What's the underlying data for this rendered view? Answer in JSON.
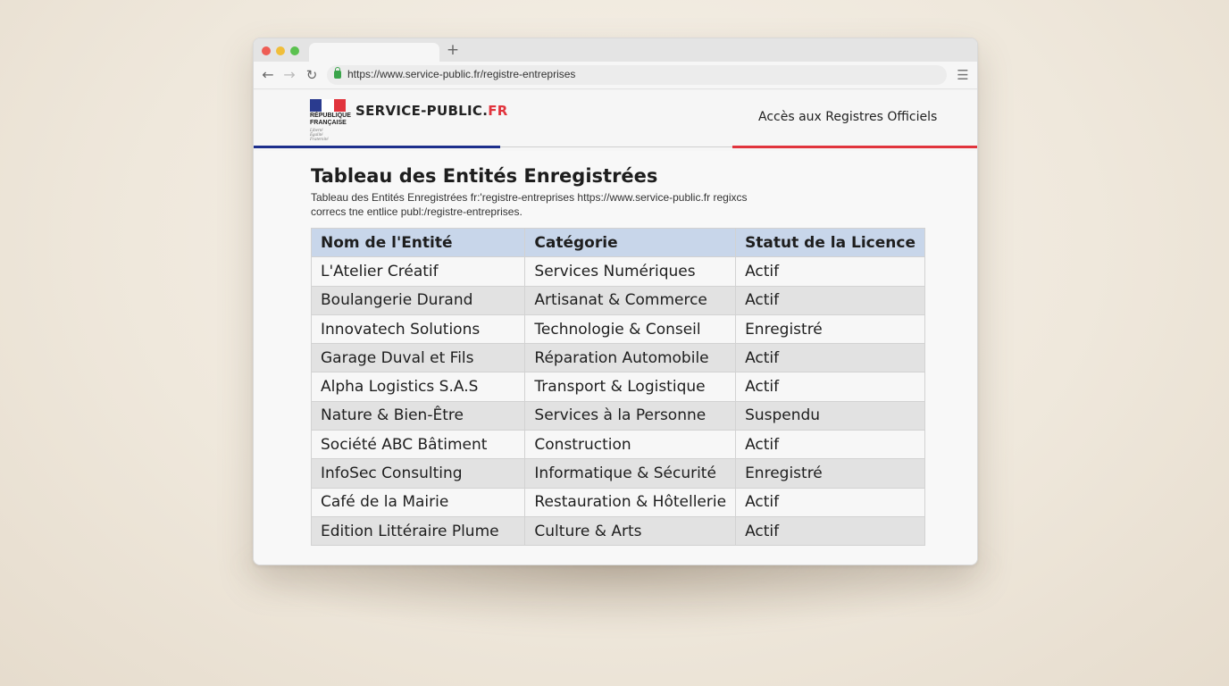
{
  "browser": {
    "new_tab_symbol": "+",
    "back_symbol": "←",
    "forward_symbol": "→",
    "reload_symbol": "↻",
    "url": "https://www.service-public.fr/registre-entreprises",
    "menu_symbol": "☰"
  },
  "header": {
    "logo_text": "RÉPUBLIQUE\nFRANÇAISE",
    "logo_motto": "Liberté\nÉgalité\nFraternité",
    "site_name_main": "SERVICE-PUBLIC.",
    "site_name_tld": "FR",
    "nav_link": "Accès aux Registres Officiels",
    "colors": {
      "blue": "#1d2f8c",
      "red": "#e1343d"
    }
  },
  "main": {
    "title": "Tableau des Entités Enregistrées",
    "description": "Tableau des Entités Enregistrées fr:'registre-entreprises https://www.service-public.fr regixcs\ncorrecs tne entlice publ:/registre-entreprises."
  },
  "table": {
    "headers": [
      "Nom de l'Entité",
      "Catégorie",
      "Statut de la Licence"
    ],
    "rows": [
      [
        "L'Atelier Créatif",
        "Services Numériques",
        "Actif"
      ],
      [
        "Boulangerie Durand",
        "Artisanat & Commerce",
        "Actif"
      ],
      [
        "Innovatech Solutions",
        "Technologie & Conseil",
        "Enregistré"
      ],
      [
        "Garage Duval et Fils",
        "Réparation Automobile",
        "Actif"
      ],
      [
        "Alpha Logistics S.A.S",
        "Transport & Logistique",
        "Actif"
      ],
      [
        "Nature & Bien-Être",
        "Services à la Personne",
        "Suspendu"
      ],
      [
        "Société ABC Bâtiment",
        "Construction",
        "Actif"
      ],
      [
        "InfoSec Consulting",
        "Informatique & Sécurité",
        "Enregistré"
      ],
      [
        "Café de la Mairie",
        "Restauration & Hôtellerie",
        "Actif"
      ],
      [
        "Edition Littéraire Plume",
        "Culture & Arts",
        "Actif"
      ]
    ]
  }
}
